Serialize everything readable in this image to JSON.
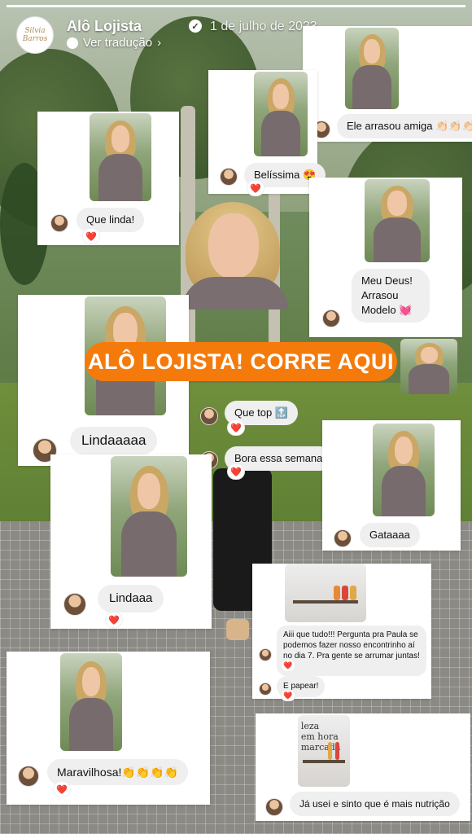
{
  "header": {
    "account_name": "Alô Lojista",
    "date": "1 de julho de 2023",
    "translate_label": "Ver tradução",
    "avatar_lettering": "Silvia Barros",
    "story_progress": 1.0
  },
  "banner": {
    "text": "ALÔ LOJISTA! CORRE AQUI",
    "color": "#f47b0b"
  },
  "comments": [
    {
      "id": "ele-arrasou",
      "text": "Ele arrasou amiga 👏🏻👏🏻👏🏻",
      "reaction": ""
    },
    {
      "id": "belissima",
      "text": "Belíssima 😍",
      "reaction": "❤️"
    },
    {
      "id": "que-linda",
      "text": "Que linda!",
      "reaction": "❤️"
    },
    {
      "id": "meu-deus",
      "text": "Meu Deus!\nArrasou\nModelo 💓",
      "reaction": ""
    },
    {
      "id": "que-top",
      "text": "Que top 🔝",
      "reaction": "❤️"
    },
    {
      "id": "lindaaaaa",
      "text": "Lindaaaaa",
      "reaction": ""
    },
    {
      "id": "bora",
      "text": "Bora essa semana",
      "reaction": "❤️"
    },
    {
      "id": "gataaaa",
      "text": "Gataaaa",
      "reaction": ""
    },
    {
      "id": "lindaaa",
      "text": "Lindaaa",
      "reaction": "❤️"
    },
    {
      "id": "aiii",
      "text": "Aiii que tudo!!! Pergunta pra Paula se podemos fazer nosso encontrinho aí no dia 7. Pra gente se arrumar juntas!🥰",
      "reaction": "❤️"
    },
    {
      "id": "papear",
      "text": "E papear!",
      "reaction": "❤️"
    },
    {
      "id": "maravilhosa",
      "text": "Maravilhosa!👏👏👏👏",
      "reaction": "❤️"
    },
    {
      "id": "ja-usei",
      "text": "Já usei e sinto que é mais nutrição",
      "reaction": ""
    }
  ],
  "shop_photo": {
    "lettering": "leza\nem hora\nmarcada"
  }
}
